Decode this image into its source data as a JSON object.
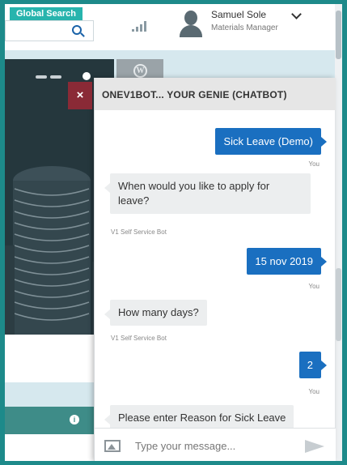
{
  "header": {
    "global_search_label": "Global Search",
    "user_name": "Samuel Sole",
    "user_role": "Materials Manager"
  },
  "chat": {
    "title": "ONEV1BOT... YOUR GENIE (CHATBOT)",
    "close_label": "×",
    "messages": [
      {
        "from": "user",
        "text": "Sick Leave (Demo)",
        "meta": "You"
      },
      {
        "from": "bot",
        "text": "When would you like to apply for leave?",
        "meta": "V1 Self Service Bot"
      },
      {
        "from": "user",
        "text": "15 nov 2019",
        "meta": "You"
      },
      {
        "from": "bot",
        "text": "How many days?",
        "meta": "V1 Self Service Bot"
      },
      {
        "from": "user",
        "text": "2",
        "meta": "You"
      },
      {
        "from": "bot",
        "text": "Please enter Reason for Sick Leave",
        "meta": ""
      }
    ],
    "input_placeholder": "Type your message..."
  }
}
